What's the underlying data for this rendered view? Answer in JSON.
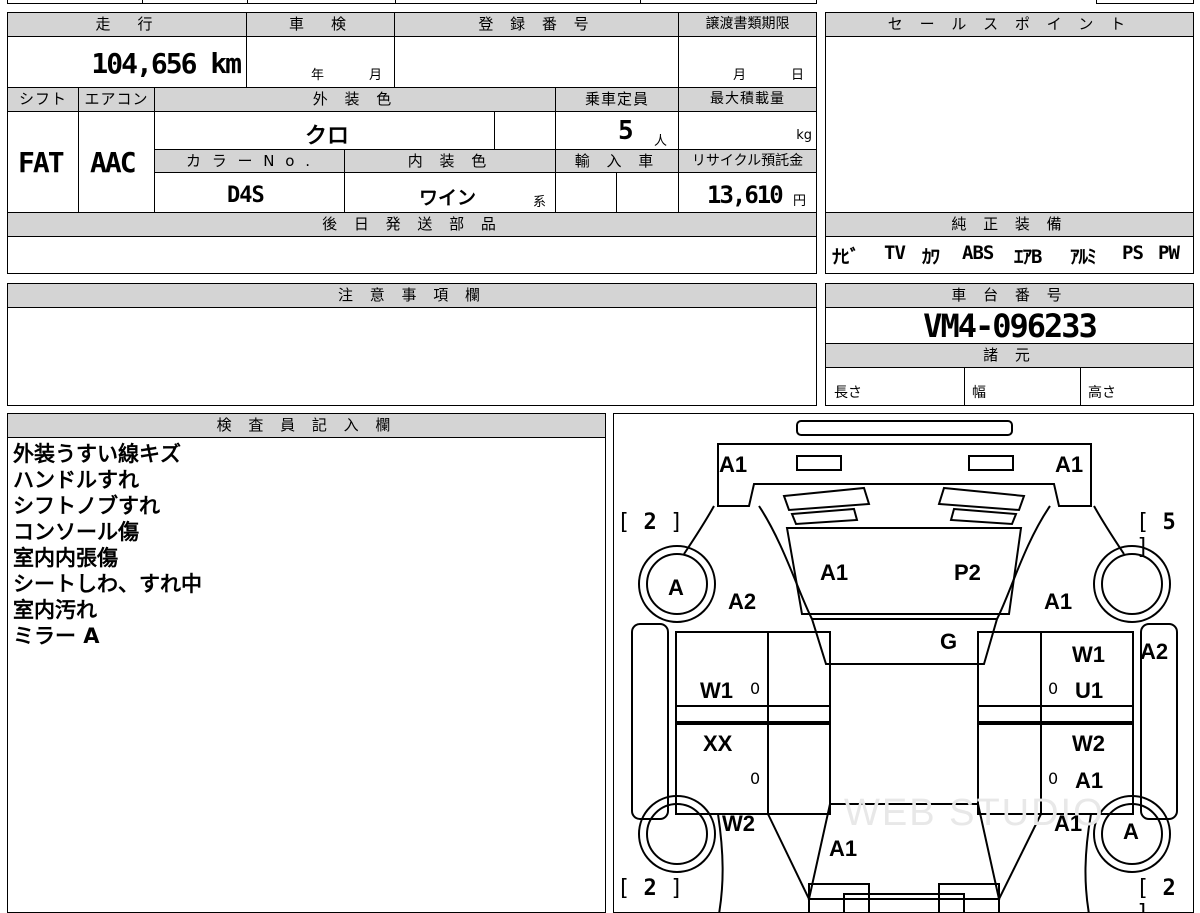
{
  "vehicle": {
    "mileage_label": "走　行",
    "mileage": "104,656 km",
    "shaken_label": "車　検",
    "shaken_year": "年",
    "shaken_month": "月",
    "reg_label": "登 録 番 号",
    "transfer_label": "譲渡書類期限",
    "transfer_month": "月",
    "transfer_day": "日",
    "shift_label": "シフト",
    "shift": "FAT",
    "ac_label": "エアコン",
    "ac": "AAC",
    "ext_color_label": "外 装 色",
    "ext_color": "クロ",
    "capacity_label": "乗車定員",
    "capacity": "5",
    "capacity_unit": "人",
    "load_label": "最大積載量",
    "load_unit": "kg",
    "color_no_label": "カ ラ ー N o .",
    "color_no": "D4S",
    "int_color_label": "内 装 色",
    "int_color": "ワイン",
    "int_color_suffix": "系",
    "import_label": "輸 入 車",
    "recycle_label": "リサイクル預託金",
    "recycle": "13,610",
    "recycle_unit": "円"
  },
  "sales_point": {
    "label": "セ ー ル ス ポ イ ン ト"
  },
  "parts": {
    "label": "後 日 発 送 部 品"
  },
  "equipment": {
    "label": "純 正 装 備",
    "items": [
      "ﾅﾋﾞ",
      "TV",
      "ｶﾜ",
      "ABS",
      "ｴｱB",
      "ｱﾙﾐ",
      "PS",
      "PW"
    ]
  },
  "notes": {
    "label": "注 意 事 項 欄"
  },
  "chassis": {
    "label": "車 台 番 号",
    "number": "VM4-096233"
  },
  "specs": {
    "label": "諸 元",
    "length": "長さ",
    "width": "幅",
    "height": "高さ"
  },
  "inspector": {
    "label": "検 査 員 記 入 欄",
    "lines": [
      "外装うすい線キズ",
      "ハンドルすれ",
      "シフトノブすれ",
      "コンソール傷",
      "室内内張傷",
      "シートしわ、すれ中",
      "室内汚れ",
      "ミラー A"
    ]
  },
  "diagram": {
    "a1_rear_left": "A1",
    "a1_rear_right": "A1",
    "b2_left_top": "2",
    "b5_right_top": "5",
    "b2_left_bottom": "2",
    "b2_right_bottom": "2",
    "wheel_left_top": "A",
    "wheel_right_bottom": "A",
    "a2_left": "A2",
    "a1_glass": "A1",
    "p2_glass": "P2",
    "a1_right": "A1",
    "g_roof": "G",
    "a2_right": "A2",
    "w1_left": "W1",
    "w1_right": "W1",
    "u1_right": "U1",
    "xx_left": "XX",
    "w2_right": "W2",
    "a1_right2": "A1",
    "w2_left": "W2",
    "a1_right3": "A1",
    "a1_hood": "A1",
    "z1": "0",
    "z2": "0",
    "z3": "0",
    "z4": "0",
    "watermark": "WEB STUDIO"
  }
}
